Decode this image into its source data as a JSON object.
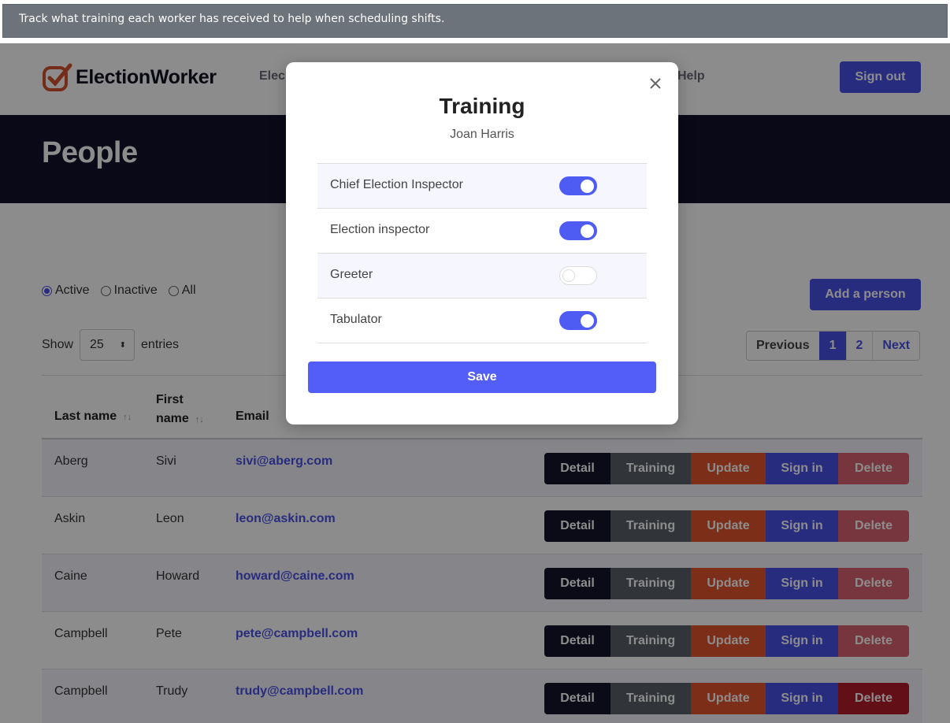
{
  "caption": "Track what training each worker has received to help when scheduling shifts.",
  "navbar": {
    "brand": "ElectionWorker",
    "links": [
      "Elec",
      "Help"
    ],
    "signout_label": "Sign out"
  },
  "hero": {
    "title": "People"
  },
  "filters": {
    "options": [
      {
        "label": "Active",
        "checked": true
      },
      {
        "label": "Inactive",
        "checked": false
      },
      {
        "label": "All",
        "checked": false
      }
    ],
    "add_label": "Add a person"
  },
  "entries": {
    "show_label": "Show",
    "value": "25",
    "suffix": "entries"
  },
  "pagination": {
    "previous": "Previous",
    "pages": [
      "1",
      "2"
    ],
    "current": "1",
    "next": "Next"
  },
  "table": {
    "headers": {
      "last": "Last name",
      "first_line1": "First",
      "first_line2": "name",
      "email": "Email"
    },
    "sort_icon": "↑↓",
    "actions": {
      "detail": "Detail",
      "training": "Training",
      "update": "Update",
      "signin": "Sign in",
      "delete": "Delete"
    },
    "rows": [
      {
        "last": "Aberg",
        "first": "Sivi",
        "email": "sivi@aberg.com"
      },
      {
        "last": "Askin",
        "first": "Leon",
        "email": "leon@askin.com"
      },
      {
        "last": "Caine",
        "first": "Howard",
        "email": "howard@caine.com"
      },
      {
        "last": "Campbell",
        "first": "Pete",
        "email": "pete@campbell.com"
      },
      {
        "last": "Campbell",
        "first": "Trudy",
        "email": "trudy@campbell.com"
      }
    ]
  },
  "modal": {
    "title": "Training",
    "subtitle": "Joan Harris",
    "trainings": [
      {
        "label": "Chief Election Inspector",
        "enabled": true
      },
      {
        "label": "Election inspector",
        "enabled": true
      },
      {
        "label": "Greeter",
        "enabled": false
      },
      {
        "label": "Tabulator",
        "enabled": true
      }
    ],
    "save_label": "Save"
  },
  "colors": {
    "accent": "#4a51e6",
    "hero": "#12122a",
    "caption": "#6c737b"
  }
}
